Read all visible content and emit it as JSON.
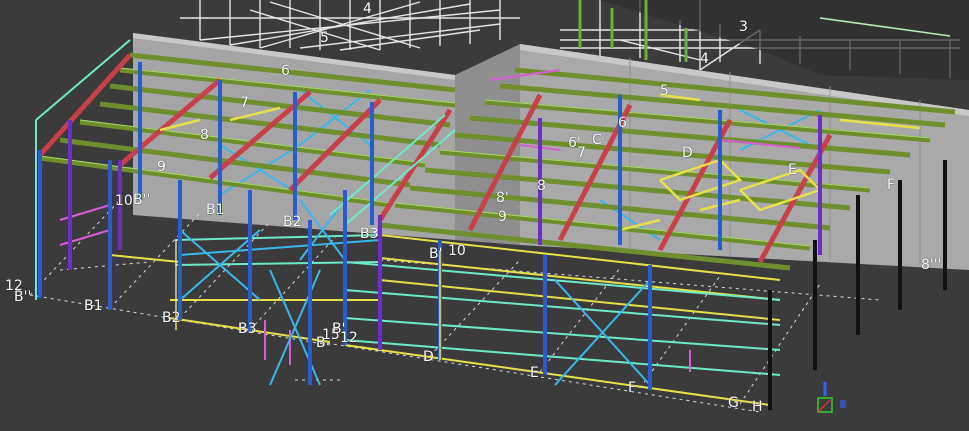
{
  "viewport": {
    "background": "#3b3b3b",
    "ground_color": "#333333"
  },
  "colors": {
    "wall": "#a9a9a9",
    "wall_dark": "#8e8e8e",
    "column_blue": "#2a5bd1",
    "column_purple": "#6b2fc9",
    "column_black": "#111111",
    "purlin_green": "#6f8f2e",
    "rafter_red": "#c8404a",
    "brace_cyan": "#3ab7e8",
    "girt_yellow": "#e8e04a",
    "girt_pink": "#d35fd3",
    "girt_green": "#6fe86f",
    "grid_line": "#d8d8d8",
    "upper_frame": "#e6e6e6"
  },
  "grid_labels": [
    {
      "id": "lbl-4-top",
      "text": "4"
    },
    {
      "id": "lbl-5-top",
      "text": "5"
    },
    {
      "id": "lbl-6-left",
      "text": "6"
    },
    {
      "id": "lbl-7-left",
      "text": "7"
    },
    {
      "id": "lbl-8-left",
      "text": "8"
    },
    {
      "id": "lbl-9-left",
      "text": "9"
    },
    {
      "id": "lbl-10-left",
      "text": "10"
    },
    {
      "id": "lbl-bpp-left",
      "text": "B''"
    },
    {
      "id": "lbl-b1-upper",
      "text": "B1"
    },
    {
      "id": "lbl-b2-upper",
      "text": "B2"
    },
    {
      "id": "lbl-b3-upper",
      "text": "B3"
    },
    {
      "id": "lbl-12-left",
      "text": "12"
    },
    {
      "id": "lbl-bpp-bottom",
      "text": "B''"
    },
    {
      "id": "lbl-b1-bottom",
      "text": "B1"
    },
    {
      "id": "lbl-b2-bottom",
      "text": "B2"
    },
    {
      "id": "lbl-b3-bottom",
      "text": "B3"
    },
    {
      "id": "lbl-15-bottom",
      "text": "15"
    },
    {
      "id": "lbl-bp-bottom",
      "text": "B'"
    },
    {
      "id": "lbl-b-bottom",
      "text": "B"
    },
    {
      "id": "lbl-12-bottom",
      "text": "12"
    },
    {
      "id": "lbl-3-right",
      "text": "3"
    },
    {
      "id": "lbl-4-right",
      "text": "4"
    },
    {
      "id": "lbl-5-right",
      "text": "5"
    },
    {
      "id": "lbl-6-right",
      "text": "6"
    },
    {
      "id": "lbl-6p-right",
      "text": "6'"
    },
    {
      "id": "lbl-7-right",
      "text": "7"
    },
    {
      "id": "lbl-c",
      "text": "C"
    },
    {
      "id": "lbl-d-upper",
      "text": "D"
    },
    {
      "id": "lbl-e-upper",
      "text": "E"
    },
    {
      "id": "lbl-f-upper",
      "text": "F"
    },
    {
      "id": "lbl-8-right",
      "text": "8"
    },
    {
      "id": "lbl-8p-right",
      "text": "8'"
    },
    {
      "id": "lbl-9-right",
      "text": "9"
    },
    {
      "id": "lbl-bp-mid",
      "text": "B'"
    },
    {
      "id": "lbl-10-mid",
      "text": "10"
    },
    {
      "id": "lbl-8ppp",
      "text": "8'''"
    },
    {
      "id": "lbl-d-bottom",
      "text": "D"
    },
    {
      "id": "lbl-e-bottom",
      "text": "E"
    },
    {
      "id": "lbl-f-bottom",
      "text": "F"
    },
    {
      "id": "lbl-g-bottom",
      "text": "G"
    },
    {
      "id": "lbl-h-bottom",
      "text": "H"
    }
  ],
  "gizmo": {
    "icon": "ucs-axis-icon",
    "x_color": "#e03030",
    "y_color": "#30d030",
    "z_color": "#3060ff"
  }
}
